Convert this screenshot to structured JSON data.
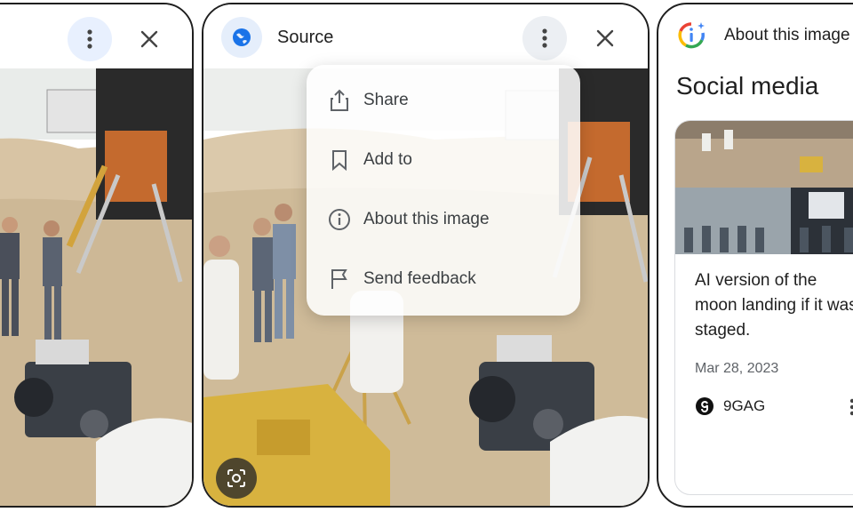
{
  "panel2": {
    "title": "Source",
    "menu": [
      {
        "label": "Share",
        "icon": "share-icon"
      },
      {
        "label": "Add to",
        "icon": "bookmark-icon"
      },
      {
        "label": "About this image",
        "icon": "info-icon"
      },
      {
        "label": "Send feedback",
        "icon": "flag-icon"
      }
    ]
  },
  "panel3": {
    "header": "About this image",
    "section": "Social media",
    "card": {
      "caption": "AI version of the moon landing if it was staged.",
      "date": "Mar 28, 2023",
      "source": "9GAG"
    }
  },
  "colors": {
    "accent_blue": "#1a73e8",
    "menu_button_bg": "#eceff3",
    "sand": "#d9c6a8"
  }
}
